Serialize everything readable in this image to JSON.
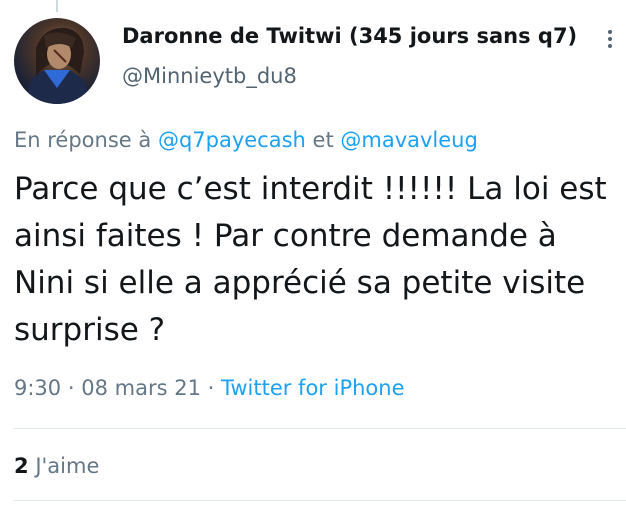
{
  "author": {
    "display_name": "Daronne de Twitwi (345 jours sans q7)",
    "handle": "@Minnieytb_du8",
    "avatar_icon": "avatar-illustration"
  },
  "reply": {
    "prefix": "En réponse à",
    "mention_1": "@q7payecash",
    "conjunction": "et",
    "mention_2": "@mavavleug"
  },
  "tweet": {
    "text": "Parce que c’est interdit !!!!!! La loi est ainsi faites ! Par contre demande à Nini si elle a apprécié sa petite visite surprise ?"
  },
  "meta": {
    "time": "9:30",
    "separator": "·",
    "date": "08 mars 21",
    "source": "Twitter for iPhone"
  },
  "stats": {
    "likes_count": "2",
    "likes_label": "J'aime"
  },
  "colors": {
    "link": "#1da1f2",
    "secondary_text": "#657786",
    "primary_text": "#14171a",
    "divider": "#e1e8ed"
  }
}
